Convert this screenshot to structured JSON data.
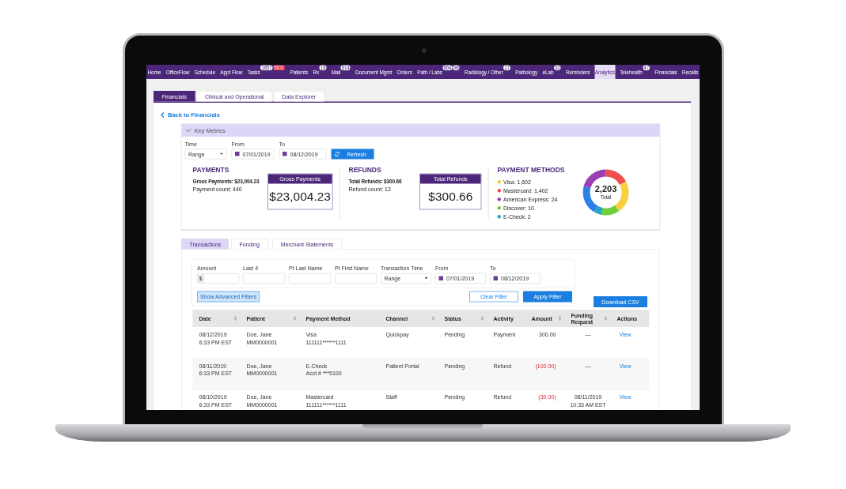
{
  "nav": [
    {
      "label": "Home",
      "selected": false
    },
    {
      "label": "OfficeFlow",
      "selected": false
    },
    {
      "label": "Schedule",
      "selected": false
    },
    {
      "label": "Appt Flow",
      "selected": false
    },
    {
      "label": "Tasks",
      "selected": false,
      "badges": [
        {
          "text": "1857",
          "alert": false
        },
        {
          "text": "5832",
          "alert": true
        }
      ]
    },
    {
      "label": "Patients",
      "selected": false
    },
    {
      "label": "Rx",
      "selected": false,
      "badges": [
        {
          "text": "18",
          "alert": false
        }
      ]
    },
    {
      "label": "Mail",
      "selected": false,
      "badges": [
        {
          "text": "614",
          "alert": false
        }
      ]
    },
    {
      "label": "Document Mgmt",
      "selected": false
    },
    {
      "label": "Orders",
      "selected": false
    },
    {
      "label": "Path / Labs",
      "selected": false,
      "badges": [
        {
          "text": "664",
          "alert": false
        },
        {
          "text": "98",
          "alert": false
        }
      ]
    },
    {
      "label": "Radiology / Other",
      "selected": false,
      "badges": [
        {
          "text": "17",
          "alert": false
        }
      ]
    },
    {
      "label": "Pathology",
      "selected": false
    },
    {
      "label": "eLab",
      "selected": false,
      "badges": [
        {
          "text": "52",
          "alert": false
        }
      ]
    },
    {
      "label": "Reminders",
      "selected": false
    },
    {
      "label": "Analytics",
      "selected": true
    },
    {
      "label": "Telehealth",
      "selected": false,
      "badges": [
        {
          "text": "47",
          "alert": false
        }
      ]
    },
    {
      "label": "Financials",
      "selected": false
    },
    {
      "label": "Recalls",
      "selected": false
    }
  ],
  "tabs": [
    {
      "label": "Financials",
      "selected": true
    },
    {
      "label": "Clinical and Operational",
      "selected": false
    },
    {
      "label": "Data Explorer",
      "selected": false
    }
  ],
  "back_link": "Back to Financials",
  "key_metrics": {
    "title": "Key Metrics",
    "expanded": true,
    "time": {
      "label": "Time",
      "value": "Range"
    },
    "from": {
      "label": "From",
      "value": "07/01/2019"
    },
    "to": {
      "label": "To",
      "value": "08/12/2019"
    },
    "refresh": "Refresh",
    "payments": {
      "heading": "PAYMENTS",
      "total": "Gross Payments: $23,004.23",
      "count": "Payment count: 440",
      "card_title": "Gross Payments",
      "card_value": "$23,004.23"
    },
    "refunds": {
      "heading": "REFUNDS",
      "total": "Total Refunds: $300.66",
      "count": "Refund count: 12",
      "card_title": "Total Refunds",
      "card_value": "$300.66"
    },
    "payment_methods": {
      "heading": "PAYMENT METHODS",
      "items": [
        {
          "label": "Visa: 1,602",
          "color": "#f5c933"
        },
        {
          "label": "Mastercard: 1,402",
          "color": "#f04e4e"
        },
        {
          "label": "American Express: 24",
          "color": "#9b3fb5"
        },
        {
          "label": "Discover: 10",
          "color": "#6fcf3a"
        },
        {
          "label": "E-Check: 2",
          "color": "#22a7c6"
        }
      ],
      "total_value": "2,203",
      "total_label": "Total"
    }
  },
  "subtabs": [
    {
      "label": "Transactions",
      "selected": true
    },
    {
      "label": "Funding",
      "selected": false
    },
    {
      "label": "Merchant Statements",
      "selected": false
    }
  ],
  "filters": [
    {
      "label": "Amount",
      "kind": "money",
      "prefix": "$"
    },
    {
      "label": "Last 4",
      "kind": "text"
    },
    {
      "label": "Pt Last Name",
      "kind": "text"
    },
    {
      "label": "Pt First Name",
      "kind": "text"
    },
    {
      "label": "Transaction Time",
      "kind": "select",
      "value": "Range"
    },
    {
      "label": "From",
      "kind": "date",
      "value": "07/01/2019"
    },
    {
      "label": "To",
      "kind": "date",
      "value": "08/12/2019"
    }
  ],
  "show_advanced": "Show Advanced Filters",
  "clear_filter": "Clear Filter",
  "apply_filter": "Apply Filter",
  "download_csv": "Download CSV",
  "table": {
    "columns": [
      {
        "label": "Date",
        "sortable": true
      },
      {
        "label": "Patient",
        "sortable": true
      },
      {
        "label": "Payment Method",
        "sortable": false
      },
      {
        "label": "Channel",
        "sortable": true
      },
      {
        "label": "Status",
        "sortable": true
      },
      {
        "label": "Activity",
        "sortable": false
      },
      {
        "label": "Amount",
        "sortable": true
      },
      {
        "label": "Funding\nRequest",
        "sortable": true
      },
      {
        "label": "Actions",
        "sortable": false
      }
    ],
    "rows": [
      {
        "date": "08/12/2019\n6:33 PM EST",
        "patient": "Doe, Jane\nMM0000001",
        "method": "Visa\n111111******1111",
        "channel": "Quickpay",
        "status": "Pending",
        "activity": "Payment",
        "amount": "300.00",
        "negative": false,
        "funding": "—",
        "action": "View"
      },
      {
        "date": "08/11/2019\n6:33 PM EST",
        "patient": "Doe, Jane\nMM0000001",
        "method": "E-Check\nAcct # ***5100",
        "channel": "Patient Portal",
        "status": "Pending",
        "activity": "Refund",
        "amount": "(100.00)",
        "negative": true,
        "funding": "—",
        "action": "View"
      },
      {
        "date": "08/10/2019\n6:33 PM EST",
        "patient": "Doe, Jane\nMM0000001",
        "method": "Mastercard\n111111******1111",
        "channel": "Staff",
        "status": "Pending",
        "activity": "Refund",
        "amount": "(30.00)",
        "negative": true,
        "funding": "08/11/2019\n10:33 AM EST",
        "action": "View"
      }
    ]
  }
}
